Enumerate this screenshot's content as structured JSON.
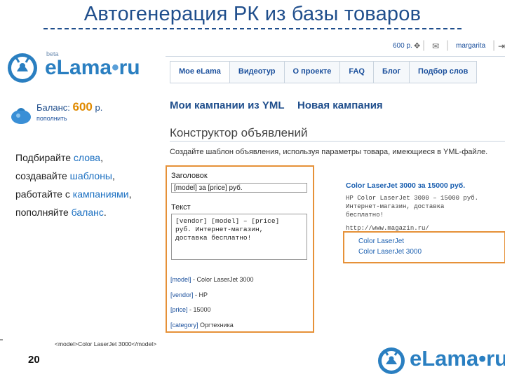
{
  "slide": {
    "title": "Автогенерация РК из базы товаров",
    "page_number": "20"
  },
  "logo": {
    "beta": "beta",
    "word": "eLama",
    "suffix": "ru"
  },
  "topbar": {
    "balance": "600 р.",
    "user": "margarita"
  },
  "nav": {
    "tabs": [
      "Мое eLama",
      "Видеотур",
      "О проекте",
      "FAQ",
      "Блог",
      "Подбор слов"
    ]
  },
  "balance": {
    "label": "Баланс:",
    "amount": "600",
    "currency": "р.",
    "refill": "пополнить"
  },
  "slogan": {
    "l1a": "Подбирайте ",
    "l1b": "слова",
    "l1c": ",",
    "l2a": "создавайте ",
    "l2b": "шаблоны",
    "l2c": ",",
    "l3a": "работайте с ",
    "l3b": "кампаниями",
    "l3c": ",",
    "l4a": "пополняйте ",
    "l4b": "баланс",
    "l4c": "."
  },
  "main": {
    "campaigns_link": "Мои кампании из YML",
    "new_campaign_link": "Новая кампания",
    "section_title": "Конструктор объявлений",
    "section_desc": "Создайте шаблон объявления, используя параметры товара, имеющиеся в YML-файле."
  },
  "form": {
    "title_label": "Заголовок",
    "title_value": "[model] за [price] руб.",
    "text_label": "Текст",
    "text_value": "[vendor] [model] – [price]\nруб. Интернет-магазин,\nдоставка бесплатно!",
    "vars": [
      {
        "key": "[model]",
        "value": " - Color LaserJet 3000"
      },
      {
        "key": "[vendor]",
        "value": " - HP"
      },
      {
        "key": "[price]",
        "value": " - 15000"
      },
      {
        "key": "[category]",
        "value": " Оргтехника"
      }
    ]
  },
  "preview": {
    "title": "Color LaserJet 3000 за 15000 руб.",
    "text": "HP Color LaserJet 3000 – 15000 руб.\nИнтернет-магазин, доставка\nбесплатно!",
    "url": "http://www.magazin.ru/",
    "sitelinks": [
      "Color LaserJet",
      "Color LaserJet 3000"
    ]
  },
  "xml_hint": "<model>Color LaserJet 3000</model>",
  "colors": {
    "accent": "#e69138",
    "brand": "#2a7fc1",
    "link": "#1a4f9c"
  }
}
